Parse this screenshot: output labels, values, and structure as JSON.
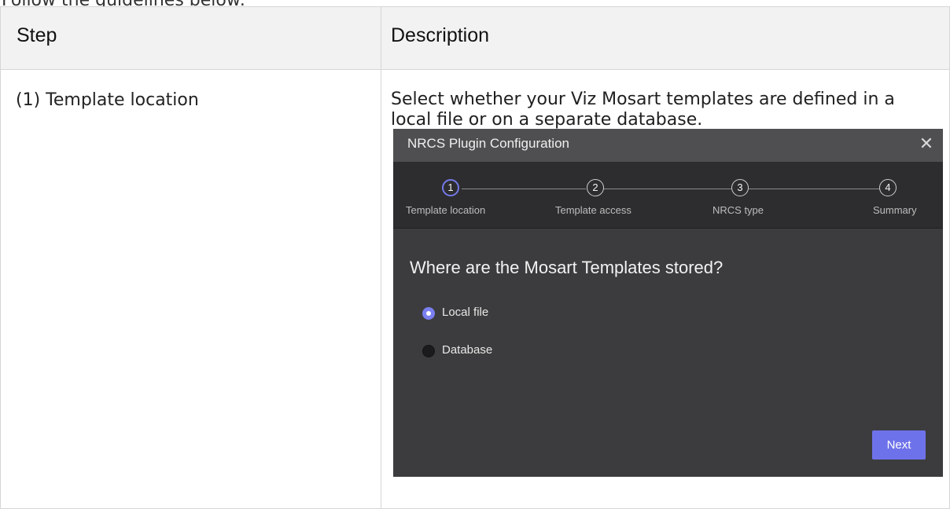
{
  "intro_text": "Follow the guidelines below:",
  "table": {
    "headers": {
      "step": "Step",
      "description": "Description"
    },
    "rows": [
      {
        "step": "(1) Template location",
        "description": "Select whether your Viz Mosart templates are defined in a local file or on a separate database."
      }
    ]
  },
  "dialog": {
    "title": "NRCS Plugin Configuration",
    "close_glyph": "✕",
    "steps": [
      {
        "number": "1",
        "label": "Template location",
        "active": true
      },
      {
        "number": "2",
        "label": "Template access",
        "active": false
      },
      {
        "number": "3",
        "label": "NRCS type",
        "active": false
      },
      {
        "number": "4",
        "label": "Summary",
        "active": false
      }
    ],
    "question": "Where are the Mosart Templates stored?",
    "options": [
      {
        "label": "Local file",
        "selected": true
      },
      {
        "label": "Database",
        "selected": false
      }
    ],
    "next_label": "Next"
  },
  "colors": {
    "accent": "#6e72ea",
    "dialog_bg": "#3c3c3e",
    "dialog_header": "#4f4f51",
    "stepper_bg": "#2d2d2f",
    "table_header_bg": "#f2f2f2",
    "border": "#d6d6d6"
  },
  "icons": {
    "close": "close-icon",
    "radio_checked": "radio-checked-icon",
    "radio_unchecked": "radio-unchecked-icon"
  }
}
